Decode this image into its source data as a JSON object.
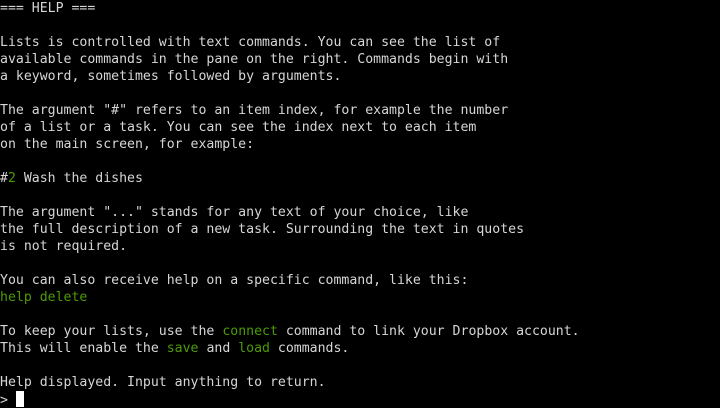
{
  "help": {
    "header": "=== HELP ===",
    "intro": [
      "Lists is controlled with text commands. You can see the list of",
      "available commands in the pane on the right. Commands begin with",
      "a keyword, sometimes followed by arguments."
    ],
    "index_arg": [
      "The argument \"#\" refers to an item index, for example the number",
      "of a list or a task. You can see the index next to each item",
      "on the main screen, for example:"
    ],
    "example_item": {
      "prefix": "#",
      "index": "2",
      "text": " Wash the dishes"
    },
    "text_arg": [
      "The argument \"...\" stands for any text of your choice, like",
      "the full description of a new task. Surrounding the text in quotes",
      "is not required."
    ],
    "specific_help": "You can also receive help on a specific command, like this:",
    "help_command_example": "help delete",
    "dropbox_line1": {
      "before": "To keep your lists, use the ",
      "command": "connect",
      "after": " command to link your Dropbox account."
    },
    "dropbox_line2": {
      "before": "This will enable the ",
      "save": "save",
      "middle": " and ",
      "load": "load",
      "after": " commands."
    },
    "status": "Help displayed. Input anything to return."
  },
  "prompt": {
    "symbol": "> ",
    "value": ""
  },
  "colors": {
    "background": "#000000",
    "text": "#d6d6d6",
    "command_highlight": "#4e9a06",
    "cursor": "#ffffff"
  }
}
